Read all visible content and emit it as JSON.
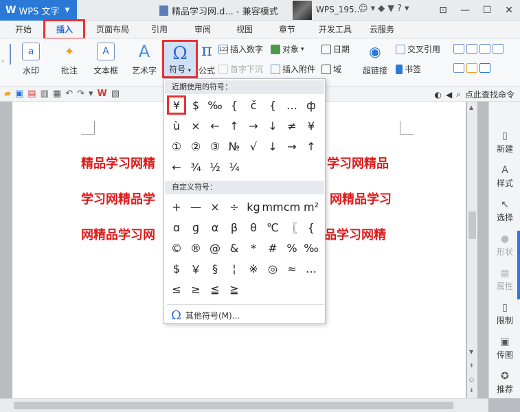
{
  "app": {
    "name": "WPS 文字",
    "logo": "W"
  },
  "title": {
    "doc": "精品学习网.d... - 兼容模式",
    "user": "WPS_195..."
  },
  "menu_tabs": [
    "开始",
    "插入",
    "页面布局",
    "引用",
    "审阅",
    "视图",
    "章节",
    "开发工具",
    "云服务"
  ],
  "ribbon": {
    "watermark": "水印",
    "comment": "批注",
    "textbox": "文本框",
    "wordart": "艺术字",
    "symbol": "符号",
    "formula": "公式",
    "insert_number": "插入数字",
    "object": "对象",
    "date": "日期",
    "drop_cap": "首字下沉",
    "attachment": "插入附件",
    "field": "域",
    "hyperlink": "超链接",
    "crossref": "交叉引用",
    "bookmark": "书签"
  },
  "quickbar": {
    "search": "点此查找命令"
  },
  "document": {
    "lines": [
      {
        "left": "精品学习网精",
        "right": "学习网精品"
      },
      {
        "left": "学习网精品学",
        "right": "网精品学习"
      },
      {
        "left": "网精品学习网",
        "right": "品学习网精"
      }
    ]
  },
  "taskpane": [
    {
      "label": "新建",
      "icon": "new-doc-icon",
      "glyph": "▯",
      "enabled": true
    },
    {
      "label": "样式",
      "icon": "style-icon",
      "glyph": "A",
      "enabled": true
    },
    {
      "label": "选择",
      "icon": "select-icon",
      "glyph": "↖",
      "enabled": true
    },
    {
      "label": "形状",
      "icon": "shape-icon",
      "glyph": "●",
      "enabled": false
    },
    {
      "label": "属性",
      "icon": "properties-icon",
      "glyph": "▦",
      "enabled": false
    },
    {
      "label": "限制",
      "icon": "restrict-icon",
      "glyph": "▯",
      "enabled": true
    },
    {
      "label": "传图",
      "icon": "upload-image-icon",
      "glyph": "▣",
      "enabled": true
    },
    {
      "label": "推荐",
      "icon": "recommend-icon",
      "glyph": "✪",
      "enabled": true
    }
  ],
  "dropdown": {
    "recent_label": "近期使用的符号：",
    "recent_rows": [
      [
        "¥",
        "$",
        "‰",
        "{",
        "č",
        "{",
        "…",
        "ф"
      ],
      [
        "ù",
        "×",
        "←",
        "↑",
        "→",
        "↓",
        "≠",
        "¥"
      ],
      [
        "①",
        "②",
        "③",
        "№",
        "√",
        "↓",
        "→",
        "↑"
      ],
      [
        "←",
        "¾",
        "½",
        "¼"
      ]
    ],
    "custom_label": "自定义符号：",
    "custom_rows": [
      [
        "+",
        "—",
        "×",
        "÷",
        "kg",
        "mm",
        "cm",
        "m²"
      ],
      [
        "ɑ",
        "ɡ",
        "α",
        "β",
        "θ",
        "℃",
        "〖",
        "{"
      ],
      [
        "©",
        "®",
        "@",
        "&",
        "*",
        "#",
        "%",
        "‰"
      ],
      [
        "$",
        "￥",
        "§",
        "¦",
        "※",
        "◎",
        "≈",
        "…"
      ],
      [
        "≤",
        "≥",
        "≦",
        "≧"
      ]
    ],
    "more_label": "其他符号(M)..."
  },
  "colors": {
    "accent": "#2b79d6",
    "highlight": "#e8312f",
    "doc_text": "#e01a1a"
  }
}
